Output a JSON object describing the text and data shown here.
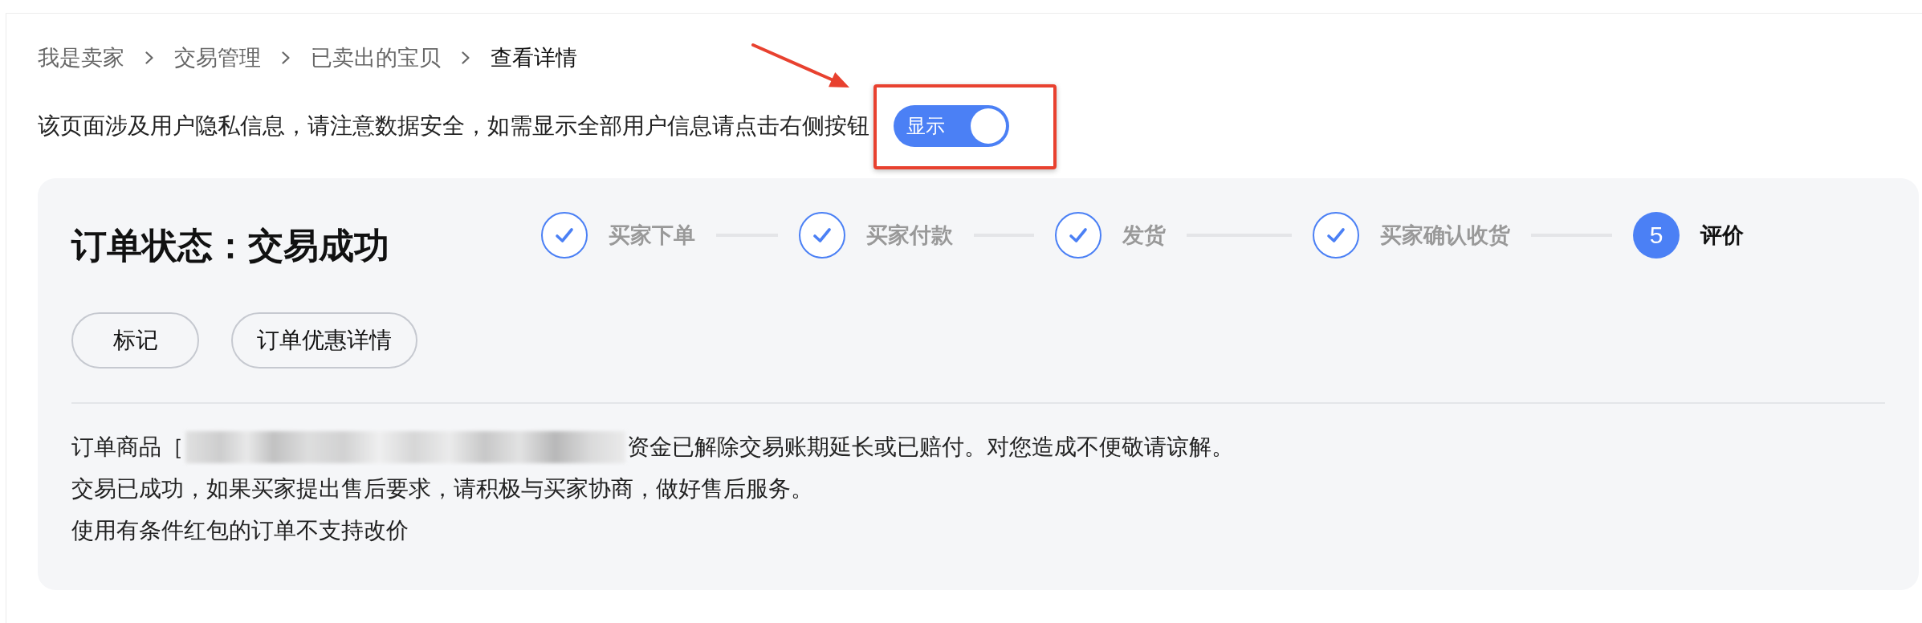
{
  "breadcrumb": [
    {
      "label": "我是卖家",
      "current": false
    },
    {
      "label": "交易管理",
      "current": false
    },
    {
      "label": "已卖出的宝贝",
      "current": false
    },
    {
      "label": "查看详情",
      "current": true
    }
  ],
  "privacy_notice": {
    "text": "该页面涉及用户隐私信息，请注意数据安全，如需显示全部用户信息请点击右侧按钮",
    "toggle": {
      "label": "显示",
      "on": true
    }
  },
  "order": {
    "status_title": "订单状态：交易成功",
    "steps": [
      {
        "label": "买家下单",
        "kind": "done"
      },
      {
        "label": "买家付款",
        "kind": "done"
      },
      {
        "label": "发货",
        "kind": "done"
      },
      {
        "label": "买家确认收货",
        "kind": "done"
      },
      {
        "label": "评价",
        "kind": "current",
        "number": "5"
      }
    ],
    "buttons": [
      "标记",
      "订单优惠详情"
    ],
    "messages": [
      {
        "kind": "redacted",
        "prefix": "订单商品［",
        "suffix": "资金已解除交易账期延长或已赔付。对您造成不便敬请谅解。"
      },
      {
        "kind": "plain",
        "text": "交易已成功，如果买家提出售后要求，请积极与买家协商，做好售后服务。"
      },
      {
        "kind": "plain",
        "text": "使用有条件红包的订单不支持改价"
      }
    ]
  }
}
